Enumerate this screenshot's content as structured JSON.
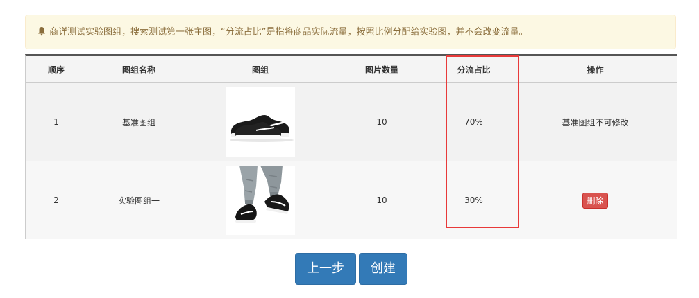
{
  "notice": {
    "icon": "bell-icon",
    "text": "商详测试实验图组，搜索测试第一张主图，“分流占比”是指将商品实际流量，按照比例分配给实验图，并不会改变流量。"
  },
  "table": {
    "headers": {
      "order": "顺序",
      "name": "图组名称",
      "images": "图组",
      "count": "图片数量",
      "ratio": "分流占比",
      "action": "操作"
    },
    "rows": [
      {
        "order": "1",
        "name": "基准图组",
        "image": "sneaker-product-image",
        "count": "10",
        "ratio": "70%",
        "action": "基准图组不可修改"
      },
      {
        "order": "2",
        "name": "实验图组一",
        "image": "sneaker-on-feet-image",
        "count": "10",
        "ratio": "30%",
        "action": "删除"
      }
    ]
  },
  "buttons": {
    "prev": "上一步",
    "create": "创建"
  },
  "colors": {
    "primary": "#337ab7",
    "danger": "#d9534f",
    "highlight": "#e83a3a",
    "notice_bg": "#fcf8e3"
  }
}
